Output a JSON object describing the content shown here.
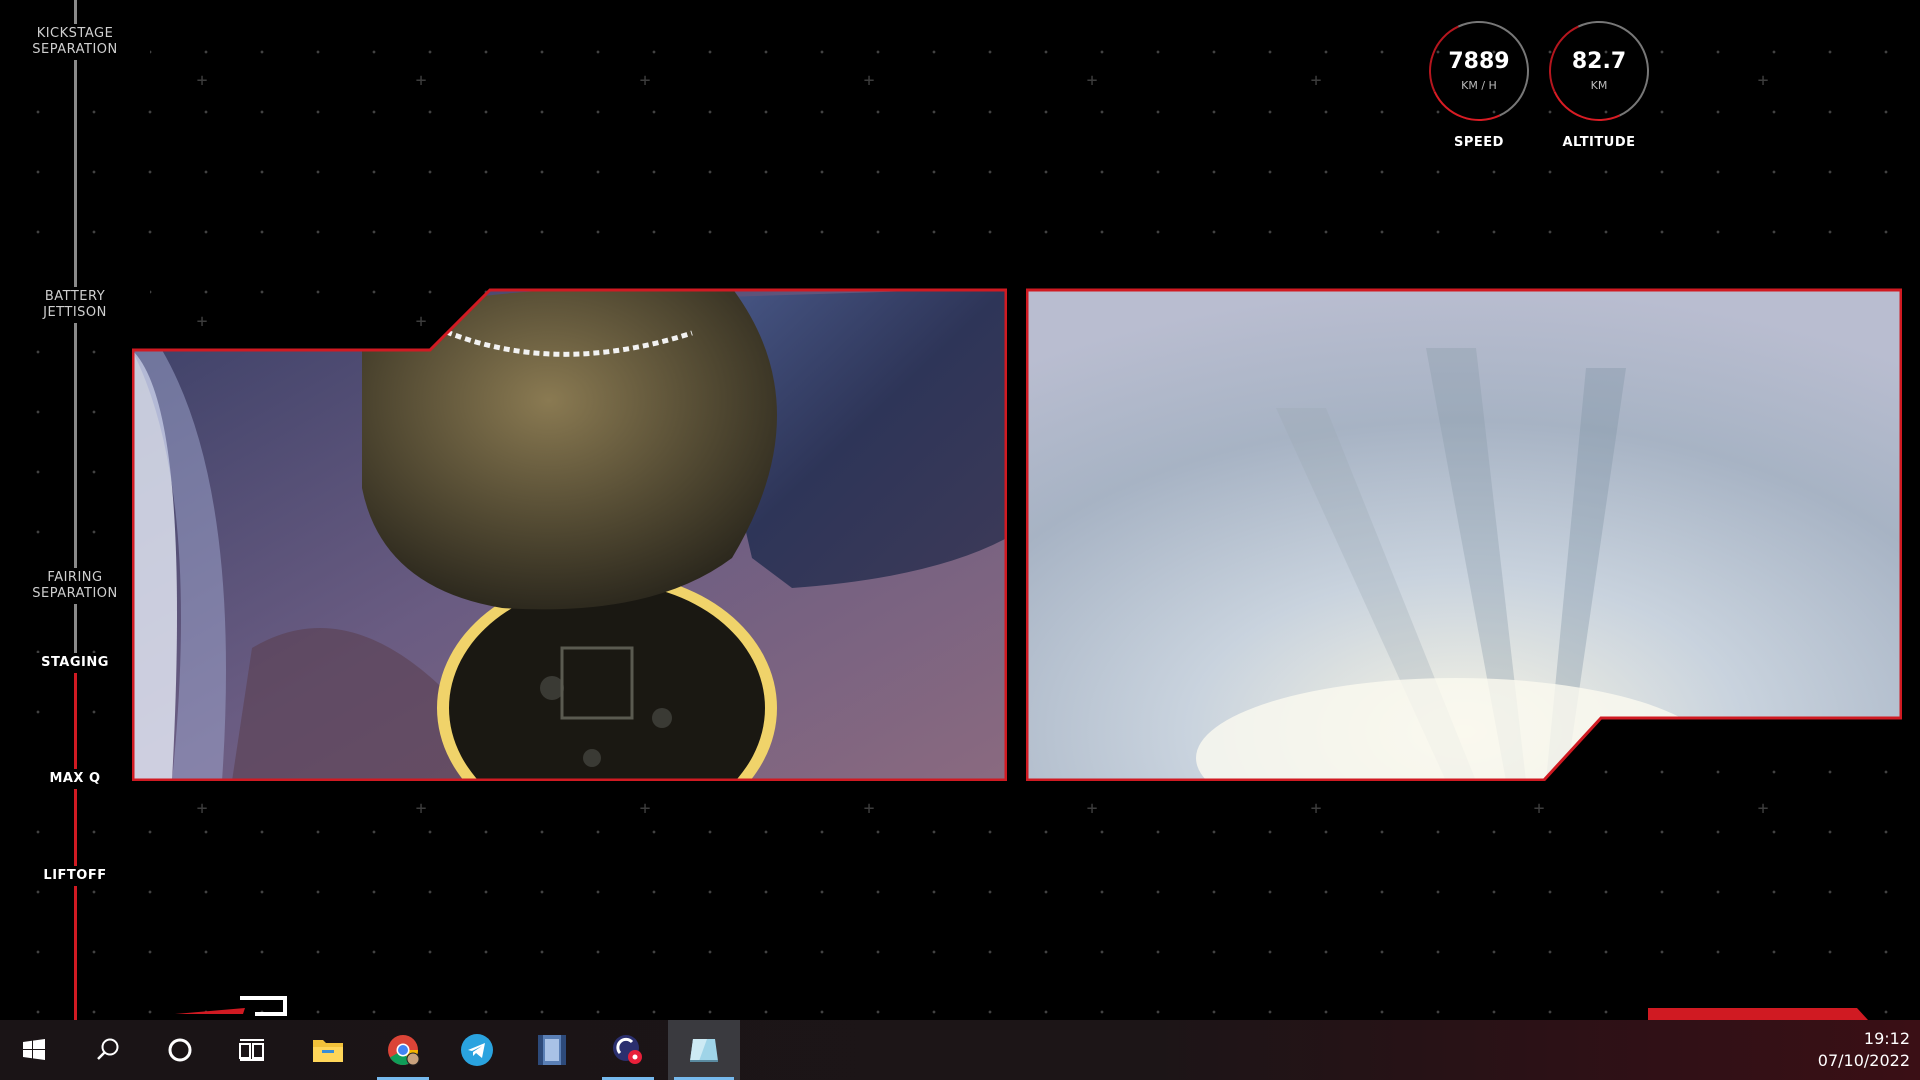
{
  "timeline": {
    "events": [
      {
        "id": "kickstage",
        "label_line1": "KICKSTAGE",
        "label_line2": "SEPARATION"
      },
      {
        "id": "battery",
        "label_line1": "BATTERY",
        "label_line2": "JETTISON"
      },
      {
        "id": "fairing",
        "label_line1": "FAIRING",
        "label_line2": "SEPARATION"
      },
      {
        "id": "staging",
        "label": "STAGING"
      },
      {
        "id": "maxq",
        "label": "MAX Q"
      },
      {
        "id": "liftoff",
        "label": "LIFTOFF"
      }
    ]
  },
  "telemetry": {
    "speed": {
      "value": "7889",
      "unit": "KM / H",
      "caption": "SPEED"
    },
    "altitude": {
      "value": "82.7",
      "unit": "KM",
      "caption": "ALTITUDE"
    }
  },
  "taskbar": {
    "apps": [
      {
        "name": "start-button",
        "icon": "windows-logo-icon"
      },
      {
        "name": "search-button",
        "icon": "search-icon"
      },
      {
        "name": "cortana-button",
        "icon": "circle-icon"
      },
      {
        "name": "task-view-button",
        "icon": "task-view-icon"
      },
      {
        "name": "file-explorer-button",
        "icon": "folder-icon"
      },
      {
        "name": "chrome-button",
        "icon": "chrome-icon"
      },
      {
        "name": "telegram-button",
        "icon": "telegram-icon"
      },
      {
        "name": "video-editor-button",
        "icon": "film-icon"
      },
      {
        "name": "recorder-button",
        "icon": "recorder-icon"
      },
      {
        "name": "app-button",
        "icon": "app-icon"
      }
    ],
    "time": "19:12",
    "date": "07/10/2022"
  },
  "colors": {
    "accent": "#d01a22",
    "taskbar_highlight": "#76b9ed"
  }
}
